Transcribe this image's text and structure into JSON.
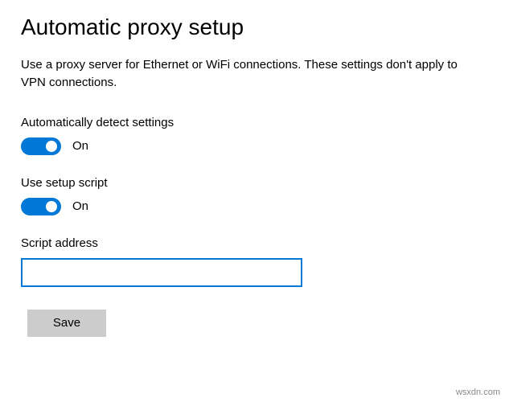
{
  "heading": "Automatic proxy setup",
  "description": "Use a proxy server for Ethernet or WiFi connections. These settings don't apply to VPN connections.",
  "settings": {
    "autoDetect": {
      "label": "Automatically detect settings",
      "state": "On",
      "on": true
    },
    "useScript": {
      "label": "Use setup script",
      "state": "On",
      "on": true
    },
    "scriptAddress": {
      "label": "Script address",
      "value": ""
    }
  },
  "buttons": {
    "save": "Save"
  },
  "colors": {
    "accent": "#0078d7",
    "buttonBg": "#cccccc"
  },
  "watermark": "wsxdn.com"
}
